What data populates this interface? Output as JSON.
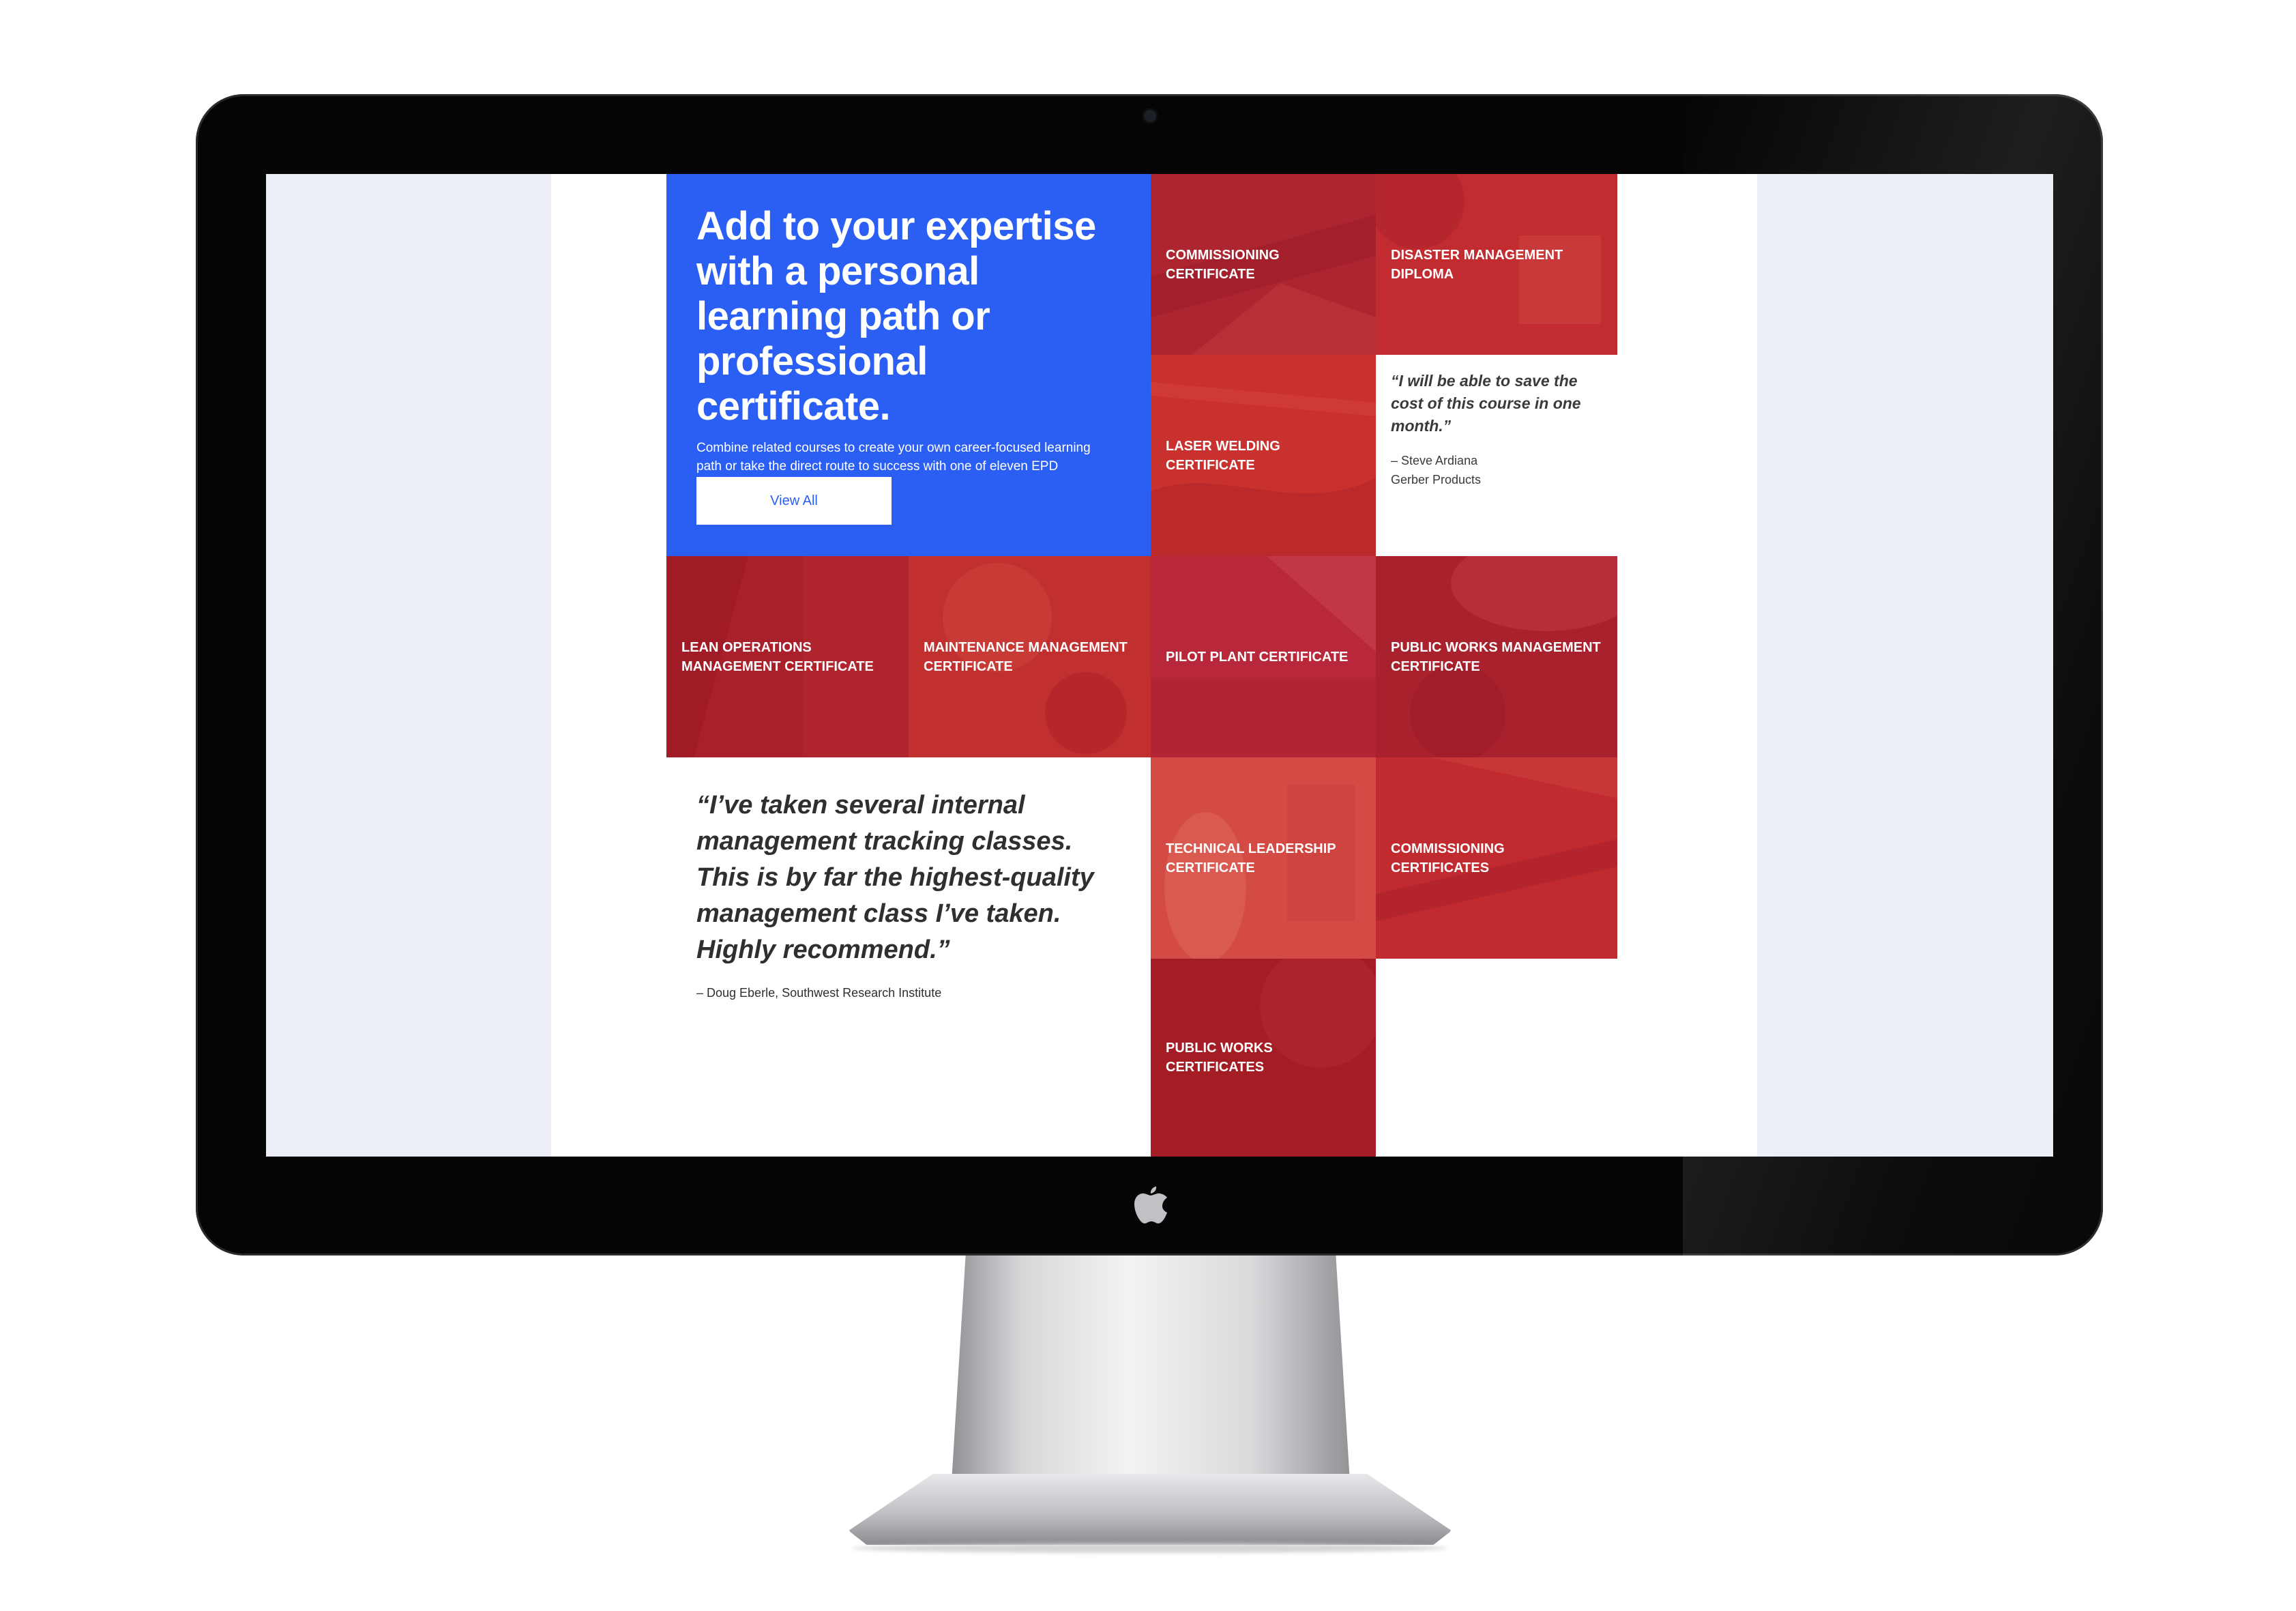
{
  "hero": {
    "title": "Add to your expertise with a personal learning path or professional certificate.",
    "body": "Combine related courses to create your own career-focused learning path or take the direct route to success with one of eleven EPD professional certificates.",
    "button_label": "View All"
  },
  "tiles": [
    {
      "label": "COMMISSIONING CERTIFICATE",
      "color": "#b02630"
    },
    {
      "label": "DISASTER MANAGEMENT DIPLOMA",
      "color": "#c0292f"
    },
    {
      "label": "LASER WELDING CERTIFICATE",
      "color": "#c8312d"
    },
    {
      "label": "LEAN OPERATIONS MANAGEMENT CERTIFICATE",
      "color": "#a91f2a"
    },
    {
      "label": "MAINTENANCE MANAGEMENT CERTIFICATE",
      "color": "#c22f2f"
    },
    {
      "label": "PILOT PLANT CERTIFICATE",
      "color": "#b8283a"
    },
    {
      "label": "PUBLIC WORKS MANAGEMENT CERTIFICATE",
      "color": "#a8212c"
    },
    {
      "label": "TECHNICAL LEADERSHIP CERTIFICATE",
      "color": "#d44a45"
    },
    {
      "label": "COMMISSIONING CERTIFICATES",
      "color": "#c12a2f"
    },
    {
      "label": "PUBLIC WORKS CERTIFICATES",
      "color": "#a41c24"
    }
  ],
  "quote_small": {
    "text": "“I will be able to save the cost of this course in one month.”",
    "author": "– Steve Ardiana\n   Gerber Products"
  },
  "quote_large": {
    "text": "“I’ve taken several internal management tracking classes. This is by far the highest-quality management class I’ve taken. Highly recommend.”",
    "author": "– Doug Eberle, Southwest Research Institute"
  },
  "colors": {
    "hero_blue": "#2b5ff4",
    "tile_red": "#b72830",
    "screen_gutter": "#eceff7"
  },
  "icons": [
    "apple-logo-icon"
  ]
}
